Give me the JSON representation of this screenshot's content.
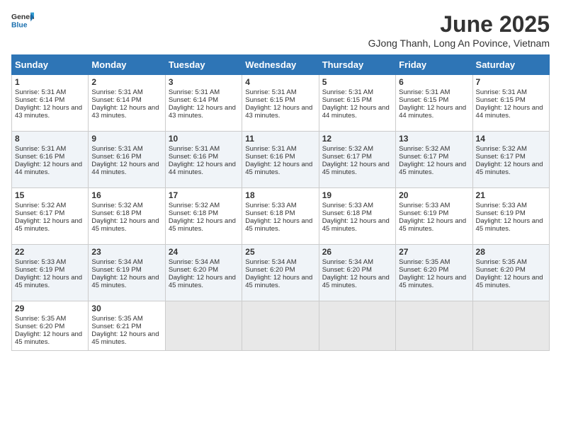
{
  "logo": {
    "general": "General",
    "blue": "Blue"
  },
  "title": "June 2025",
  "subtitle": "GJong Thanh, Long An Povince, Vietnam",
  "days_of_week": [
    "Sunday",
    "Monday",
    "Tuesday",
    "Wednesday",
    "Thursday",
    "Friday",
    "Saturday"
  ],
  "weeks": [
    [
      {
        "day": "1",
        "sunrise": "5:31 AM",
        "sunset": "6:14 PM",
        "daylight": "12 hours and 43 minutes."
      },
      {
        "day": "2",
        "sunrise": "5:31 AM",
        "sunset": "6:14 PM",
        "daylight": "12 hours and 43 minutes."
      },
      {
        "day": "3",
        "sunrise": "5:31 AM",
        "sunset": "6:14 PM",
        "daylight": "12 hours and 43 minutes."
      },
      {
        "day": "4",
        "sunrise": "5:31 AM",
        "sunset": "6:15 PM",
        "daylight": "12 hours and 43 minutes."
      },
      {
        "day": "5",
        "sunrise": "5:31 AM",
        "sunset": "6:15 PM",
        "daylight": "12 hours and 44 minutes."
      },
      {
        "day": "6",
        "sunrise": "5:31 AM",
        "sunset": "6:15 PM",
        "daylight": "12 hours and 44 minutes."
      },
      {
        "day": "7",
        "sunrise": "5:31 AM",
        "sunset": "6:15 PM",
        "daylight": "12 hours and 44 minutes."
      }
    ],
    [
      {
        "day": "8",
        "sunrise": "5:31 AM",
        "sunset": "6:16 PM",
        "daylight": "12 hours and 44 minutes."
      },
      {
        "day": "9",
        "sunrise": "5:31 AM",
        "sunset": "6:16 PM",
        "daylight": "12 hours and 44 minutes."
      },
      {
        "day": "10",
        "sunrise": "5:31 AM",
        "sunset": "6:16 PM",
        "daylight": "12 hours and 44 minutes."
      },
      {
        "day": "11",
        "sunrise": "5:31 AM",
        "sunset": "6:16 PM",
        "daylight": "12 hours and 45 minutes."
      },
      {
        "day": "12",
        "sunrise": "5:32 AM",
        "sunset": "6:17 PM",
        "daylight": "12 hours and 45 minutes."
      },
      {
        "day": "13",
        "sunrise": "5:32 AM",
        "sunset": "6:17 PM",
        "daylight": "12 hours and 45 minutes."
      },
      {
        "day": "14",
        "sunrise": "5:32 AM",
        "sunset": "6:17 PM",
        "daylight": "12 hours and 45 minutes."
      }
    ],
    [
      {
        "day": "15",
        "sunrise": "5:32 AM",
        "sunset": "6:17 PM",
        "daylight": "12 hours and 45 minutes."
      },
      {
        "day": "16",
        "sunrise": "5:32 AM",
        "sunset": "6:18 PM",
        "daylight": "12 hours and 45 minutes."
      },
      {
        "day": "17",
        "sunrise": "5:32 AM",
        "sunset": "6:18 PM",
        "daylight": "12 hours and 45 minutes."
      },
      {
        "day": "18",
        "sunrise": "5:33 AM",
        "sunset": "6:18 PM",
        "daylight": "12 hours and 45 minutes."
      },
      {
        "day": "19",
        "sunrise": "5:33 AM",
        "sunset": "6:18 PM",
        "daylight": "12 hours and 45 minutes."
      },
      {
        "day": "20",
        "sunrise": "5:33 AM",
        "sunset": "6:19 PM",
        "daylight": "12 hours and 45 minutes."
      },
      {
        "day": "21",
        "sunrise": "5:33 AM",
        "sunset": "6:19 PM",
        "daylight": "12 hours and 45 minutes."
      }
    ],
    [
      {
        "day": "22",
        "sunrise": "5:33 AM",
        "sunset": "6:19 PM",
        "daylight": "12 hours and 45 minutes."
      },
      {
        "day": "23",
        "sunrise": "5:34 AM",
        "sunset": "6:19 PM",
        "daylight": "12 hours and 45 minutes."
      },
      {
        "day": "24",
        "sunrise": "5:34 AM",
        "sunset": "6:20 PM",
        "daylight": "12 hours and 45 minutes."
      },
      {
        "day": "25",
        "sunrise": "5:34 AM",
        "sunset": "6:20 PM",
        "daylight": "12 hours and 45 minutes."
      },
      {
        "day": "26",
        "sunrise": "5:34 AM",
        "sunset": "6:20 PM",
        "daylight": "12 hours and 45 minutes."
      },
      {
        "day": "27",
        "sunrise": "5:35 AM",
        "sunset": "6:20 PM",
        "daylight": "12 hours and 45 minutes."
      },
      {
        "day": "28",
        "sunrise": "5:35 AM",
        "sunset": "6:20 PM",
        "daylight": "12 hours and 45 minutes."
      }
    ],
    [
      {
        "day": "29",
        "sunrise": "5:35 AM",
        "sunset": "6:20 PM",
        "daylight": "12 hours and 45 minutes."
      },
      {
        "day": "30",
        "sunrise": "5:35 AM",
        "sunset": "6:21 PM",
        "daylight": "12 hours and 45 minutes."
      },
      null,
      null,
      null,
      null,
      null
    ]
  ],
  "labels": {
    "sunrise": "Sunrise:",
    "sunset": "Sunset:",
    "daylight": "Daylight:"
  }
}
